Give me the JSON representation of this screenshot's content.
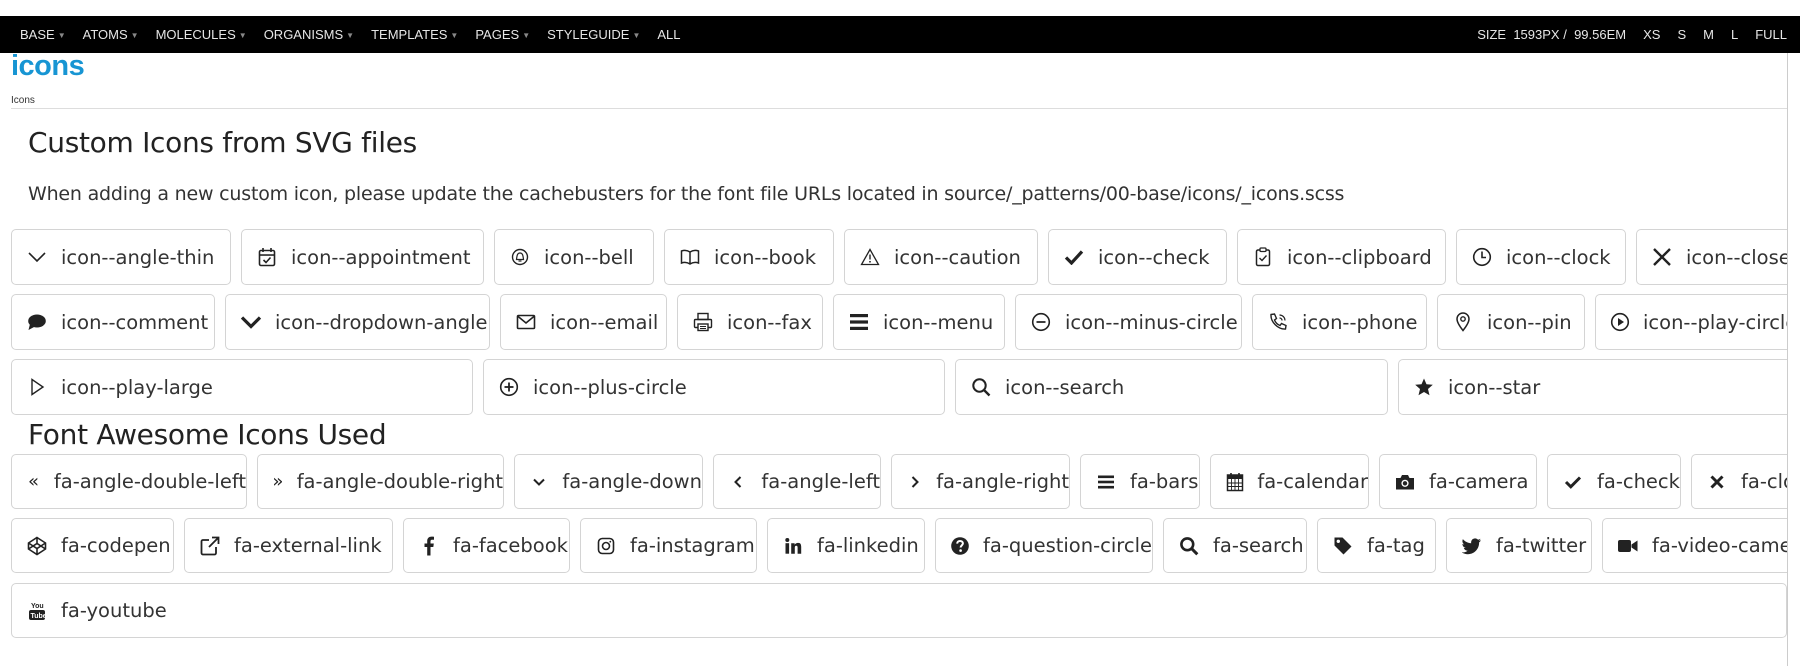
{
  "toolbar": {
    "nav": [
      {
        "label": "BASE",
        "dropdown": true
      },
      {
        "label": "ATOMS",
        "dropdown": true
      },
      {
        "label": "MOLECULES",
        "dropdown": true
      },
      {
        "label": "ORGANISMS",
        "dropdown": true
      },
      {
        "label": "TEMPLATES",
        "dropdown": true
      },
      {
        "label": "PAGES",
        "dropdown": true
      },
      {
        "label": "STYLEGUIDE",
        "dropdown": true
      },
      {
        "label": "ALL",
        "dropdown": false
      }
    ],
    "size_label": "SIZE",
    "size_px": "1593PX /",
    "size_em": "99.56EM",
    "sizes": [
      "XS",
      "S",
      "M",
      "L",
      "FULL"
    ]
  },
  "pattern": {
    "title": "icons",
    "breadcrumb": "Icons"
  },
  "custom_section": {
    "heading": "Custom Icons from SVG files",
    "description": "When adding a new custom icon, please update the cachebusters for the font file URLs located in source/_patterns/00-base/icons/_icons.scss",
    "rows": [
      [
        {
          "label": "icon--angle-thin",
          "icon": "angle-thin-icon"
        },
        {
          "label": "icon--appointment",
          "icon": "appointment-icon"
        },
        {
          "label": "icon--bell",
          "icon": "bell-icon"
        },
        {
          "label": "icon--book",
          "icon": "book-icon"
        },
        {
          "label": "icon--caution",
          "icon": "caution-icon"
        },
        {
          "label": "icon--check",
          "icon": "check-icon"
        },
        {
          "label": "icon--clipboard",
          "icon": "clipboard-icon"
        },
        {
          "label": "icon--clock",
          "icon": "clock-icon"
        },
        {
          "label": "icon--close",
          "icon": "close-icon"
        }
      ],
      [
        {
          "label": "icon--comment",
          "icon": "comment-icon"
        },
        {
          "label": "icon--dropdown-angle",
          "icon": "dropdown-angle-icon"
        },
        {
          "label": "icon--email",
          "icon": "email-icon"
        },
        {
          "label": "icon--fax",
          "icon": "fax-icon"
        },
        {
          "label": "icon--menu",
          "icon": "menu-icon"
        },
        {
          "label": "icon--minus-circle",
          "icon": "minus-circle-icon"
        },
        {
          "label": "icon--phone",
          "icon": "phone-icon"
        },
        {
          "label": "icon--pin",
          "icon": "pin-icon"
        },
        {
          "label": "icon--play-circle",
          "icon": "play-circle-icon"
        }
      ],
      [
        {
          "label": "icon--play-large",
          "icon": "play-large-icon"
        },
        {
          "label": "icon--plus-circle",
          "icon": "plus-circle-icon"
        },
        {
          "label": "icon--search",
          "icon": "search-icon"
        },
        {
          "label": "icon--star",
          "icon": "star-icon"
        }
      ]
    ]
  },
  "fa_section": {
    "heading": "Font Awesome Icons Used",
    "rows": [
      [
        {
          "label": "fa-angle-double-left",
          "icon": "angle-double-left-icon"
        },
        {
          "label": "fa-angle-double-right",
          "icon": "angle-double-right-icon"
        },
        {
          "label": "fa-angle-down",
          "icon": "angle-down-icon"
        },
        {
          "label": "fa-angle-left",
          "icon": "angle-left-icon"
        },
        {
          "label": "fa-angle-right",
          "icon": "angle-right-icon"
        },
        {
          "label": "fa-bars",
          "icon": "bars-icon"
        },
        {
          "label": "fa-calendar",
          "icon": "calendar-icon"
        },
        {
          "label": "fa-camera",
          "icon": "camera-icon"
        },
        {
          "label": "fa-check",
          "icon": "check-icon"
        },
        {
          "label": "fa-close",
          "icon": "close-icon"
        }
      ],
      [
        {
          "label": "fa-codepen",
          "icon": "codepen-icon"
        },
        {
          "label": "fa-external-link",
          "icon": "external-link-icon"
        },
        {
          "label": "fa-facebook",
          "icon": "facebook-icon"
        },
        {
          "label": "fa-instagram",
          "icon": "instagram-icon"
        },
        {
          "label": "fa-linkedin",
          "icon": "linkedin-icon"
        },
        {
          "label": "fa-question-circle",
          "icon": "question-circle-icon"
        },
        {
          "label": "fa-search",
          "icon": "search-icon"
        },
        {
          "label": "fa-tag",
          "icon": "tag-icon"
        },
        {
          "label": "fa-twitter",
          "icon": "twitter-icon"
        },
        {
          "label": "fa-video-camera",
          "icon": "video-camera-icon"
        }
      ],
      [
        {
          "label": "fa-youtube",
          "icon": "youtube-icon"
        }
      ]
    ]
  },
  "colors": {
    "toolbar_bg": "#000000",
    "title_blue": "#1795d3",
    "chip_border": "#d4d4d4"
  }
}
